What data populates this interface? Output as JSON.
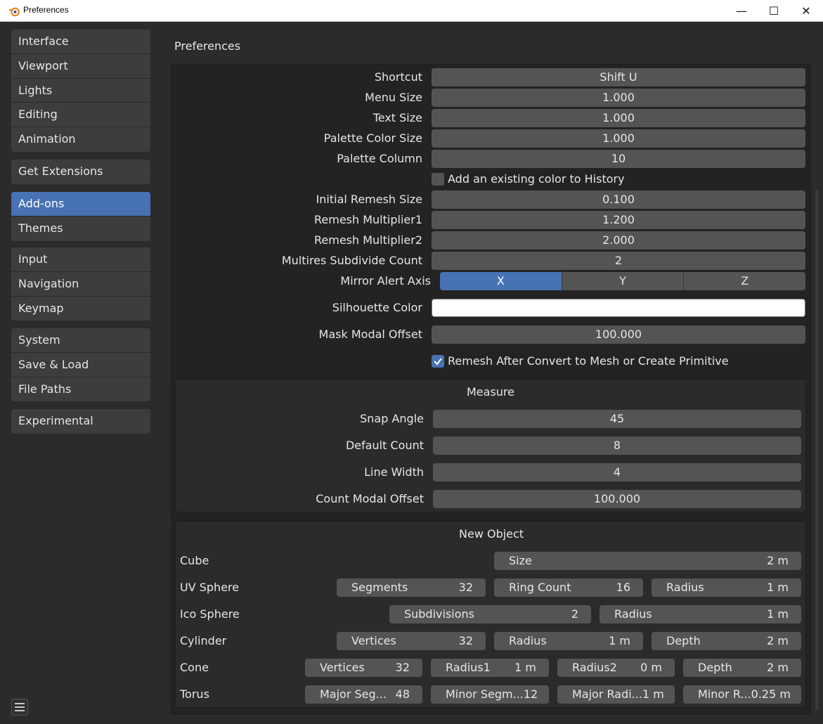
{
  "window": {
    "title": "Preferences",
    "min_glyph": "—",
    "max_glyph": "☐",
    "close_glyph": "✕"
  },
  "sidebar": {
    "groups": [
      [
        "Interface",
        "Viewport",
        "Lights",
        "Editing",
        "Animation"
      ],
      [
        "Get Extensions"
      ],
      [
        "Add-ons",
        "Themes"
      ],
      [
        "Input",
        "Navigation",
        "Keymap"
      ],
      [
        "System",
        "Save & Load",
        "File Paths"
      ],
      [
        "Experimental"
      ]
    ],
    "active": "Add-ons"
  },
  "main": {
    "header": "Preferences",
    "settings": {
      "shortcut": {
        "label": "Shortcut",
        "value": "Shift U"
      },
      "menu_size": {
        "label": "Menu Size",
        "value": "1.000"
      },
      "text_size": {
        "label": "Text Size",
        "value": "1.000"
      },
      "palette_color_size": {
        "label": "Palette Color Size",
        "value": "1.000"
      },
      "palette_column": {
        "label": "Palette Column",
        "value": "10"
      },
      "add_existing_color": {
        "label": "Add an existing color to History",
        "checked": false
      },
      "initial_remesh_size": {
        "label": "Initial Remesh Size",
        "value": "0.100"
      },
      "remesh_multiplier1": {
        "label": "Remesh Multiplier1",
        "value": "1.200"
      },
      "remesh_multiplier2": {
        "label": "Remesh Multiplier2",
        "value": "2.000"
      },
      "multires_subdivide_count": {
        "label": "Multires Subdivide Count",
        "value": "2"
      },
      "mirror_alert_axis": {
        "label": "Mirror Alert Axis",
        "options": [
          "X",
          "Y",
          "Z"
        ],
        "selected": "X"
      },
      "silhouette_color": {
        "label": "Silhouette Color",
        "color": "#ffffff"
      },
      "mask_modal_offset": {
        "label": "Mask Modal Offset",
        "value": "100.000"
      },
      "remesh_after_convert": {
        "label": "Remesh After Convert to Mesh or Create Primitive",
        "checked": true
      }
    },
    "measure": {
      "title": "Measure",
      "snap_angle": {
        "label": "Snap Angle",
        "value": "45"
      },
      "default_count": {
        "label": "Default Count",
        "value": "8"
      },
      "line_width": {
        "label": "Line Width",
        "value": "4"
      },
      "count_modal_offset": {
        "label": "Count Modal Offset",
        "value": "100.000"
      }
    },
    "new_object": {
      "title": "New Object",
      "cube": {
        "label": "Cube",
        "size": {
          "name": "Size",
          "value": "2 m"
        }
      },
      "uv_sphere": {
        "label": "UV Sphere",
        "segments": {
          "name": "Segments",
          "value": "32"
        },
        "ring_count": {
          "name": "Ring Count",
          "value": "16"
        },
        "radius": {
          "name": "Radius",
          "value": "1 m"
        }
      },
      "ico_sphere": {
        "label": "Ico Sphere",
        "subdivisions": {
          "name": "Subdivisions",
          "value": "2"
        },
        "radius": {
          "name": "Radius",
          "value": "1 m"
        }
      },
      "cylinder": {
        "label": "Cylinder",
        "vertices": {
          "name": "Vertices",
          "value": "32"
        },
        "radius": {
          "name": "Radius",
          "value": "1 m"
        },
        "depth": {
          "name": "Depth",
          "value": "2 m"
        }
      },
      "cone": {
        "label": "Cone",
        "vertices": {
          "name": "Vertices",
          "value": "32"
        },
        "radius1": {
          "name": "Radius1",
          "value": "1 m"
        },
        "radius2": {
          "name": "Radius2",
          "value": "0 m"
        },
        "depth": {
          "name": "Depth",
          "value": "2 m"
        }
      },
      "torus": {
        "label": "Torus",
        "major_segments": {
          "name": "Major Seg...",
          "value": "48"
        },
        "minor_segments": {
          "name": "Minor Segm...",
          "value": "12"
        },
        "major_radius": {
          "name": "Major Radi...",
          "value": "1 m"
        },
        "minor_radius": {
          "name": "Minor R...",
          "value": "0.25 m"
        }
      }
    }
  },
  "colors": {
    "accent": "#4772b3",
    "field": "#545454",
    "panel": "#232323",
    "background": "#2b2b2b"
  }
}
